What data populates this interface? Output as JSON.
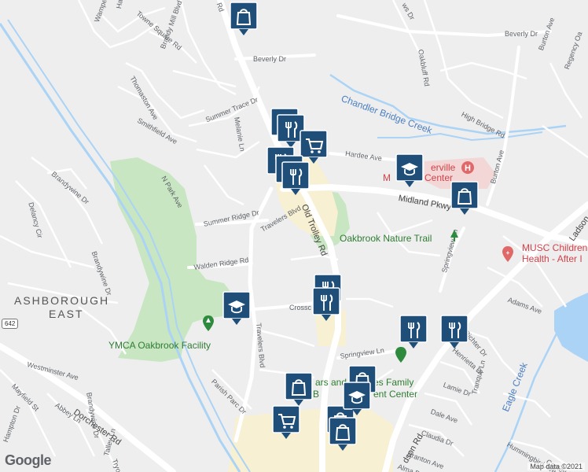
{
  "map": {
    "areas": {
      "ashborough": "ASHBOROUGH",
      "east": "EAST"
    },
    "pois": {
      "ymca": "YMCA Oakbrook Facility",
      "nature_trail": "Oakbrook Nature Trail",
      "hospital_partial": "erville",
      "hospital_line1_start": "M",
      "hospital_line2": "Center",
      "hospital_line1_end": "Center",
      "musc_line1": "MUSC Children",
      "musc_line2": "Health - After I",
      "family_center_1": "ars and",
      "family_center_2": "es Family",
      "family_center_3": "B",
      "family_center_4": "ent Center"
    },
    "water": {
      "creek1": "Chandler Bridge Creek",
      "creek2": "Eagle Creek"
    },
    "roads": {
      "old_trolley": "Old Trolley Rd",
      "midland": "Midland Pkwy",
      "travelers_blvd": "Travelers Blvd",
      "travelers_blvd_2": "Travelers Blvd",
      "beverly1": "Beverly Dr",
      "beverly2": "Beverly Dr",
      "summer_trace": "Summer Trace Dr",
      "summer_ridge": "Summer Ridge Dr",
      "walden_ridge": "Walden Ridge Rd",
      "crosscreek": "Crossc",
      "dorchester": "Dorchester Rd",
      "smithfield": "Smithfield Ave",
      "thomaston": "Thomaston Ave",
      "brandy_mill": "Brandy Mill Blvd",
      "towne_square": "Towne Square Rd",
      "melanie": "Melanie Ln",
      "n_park": "N Park Ave",
      "brandywine1": "Brandywine Dr",
      "brandywine2": "Brandywine Dr",
      "brandywine3": "Brandywine Dr",
      "delancy": "Delancy Cir",
      "westminster": "Westminster Ave",
      "mayfield": "Mayfield St",
      "abbey": "Abbey Ln",
      "hampton": "Hampton Dr",
      "parish_parc": "Parish Parc Dr",
      "hardee": "Hardee Ave",
      "high_bridge": "High Bridge Rd",
      "oakbluff": "Oakbluff Rd",
      "burton1": "Burton Ave",
      "burton2": "Burton Ave",
      "regency": "Regency Oa",
      "springview1": "Springview Ln",
      "springview2": "Springview Ln",
      "ladson": "Ladson",
      "ladson2": "dson Rd",
      "adams": "Adams Ave",
      "richter": "Richter Dr",
      "henrietta": "Henrietta Dr",
      "lamie": "Lamie Dr",
      "dale": "Dale Ave",
      "tranquil": "Tranquil Ln",
      "claudia": "Claudia Dr",
      "branton": "Branton Ave",
      "alma": "Alma Dr",
      "hummingbird": "Hummingbird Ave",
      "copley": "Copley Cir",
      "talley": "Talley Ln",
      "tryon": "Tryon",
      "wampee": "Wampee",
      "hamlin": "Hamlin",
      "lewis": "ws Dr",
      "rd_top": "Rd"
    },
    "shield": "642",
    "attribution": "Map data ©2021",
    "google": "Google",
    "colors": {
      "background": "#eeeeee",
      "park": "#c8e6c2",
      "commercial": "#f7f0d2",
      "water": "#aad3f5",
      "pin": "#1f4e79",
      "road": "#ffffff"
    },
    "pins": [
      {
        "type": "shopping",
        "icon": "shopping-bag-icon"
      },
      {
        "type": "restaurant",
        "icon": "fork-knife-icon"
      },
      {
        "type": "restaurant",
        "icon": "fork-knife-icon"
      },
      {
        "type": "grocery",
        "icon": "shopping-cart-icon"
      },
      {
        "type": "restaurant",
        "icon": "fork-knife-icon"
      },
      {
        "type": "restaurant",
        "icon": "fork-knife-icon"
      },
      {
        "type": "restaurant",
        "icon": "fork-knife-icon"
      },
      {
        "type": "school",
        "icon": "graduation-cap-icon"
      },
      {
        "type": "shopping",
        "icon": "shopping-bag-icon"
      },
      {
        "type": "restaurant",
        "icon": "fork-knife-icon"
      },
      {
        "type": "restaurant",
        "icon": "fork-knife-icon"
      },
      {
        "type": "school",
        "icon": "graduation-cap-icon"
      },
      {
        "type": "restaurant",
        "icon": "fork-knife-icon"
      },
      {
        "type": "restaurant",
        "icon": "fork-knife-icon"
      },
      {
        "type": "shopping",
        "icon": "shopping-bag-icon"
      },
      {
        "type": "shopping",
        "icon": "shopping-bag-icon"
      },
      {
        "type": "shopping",
        "icon": "shopping-bag-icon"
      },
      {
        "type": "school",
        "icon": "graduation-cap-icon"
      },
      {
        "type": "grocery",
        "icon": "shopping-cart-icon"
      },
      {
        "type": "shopping",
        "icon": "shopping-bag-icon"
      }
    ]
  }
}
